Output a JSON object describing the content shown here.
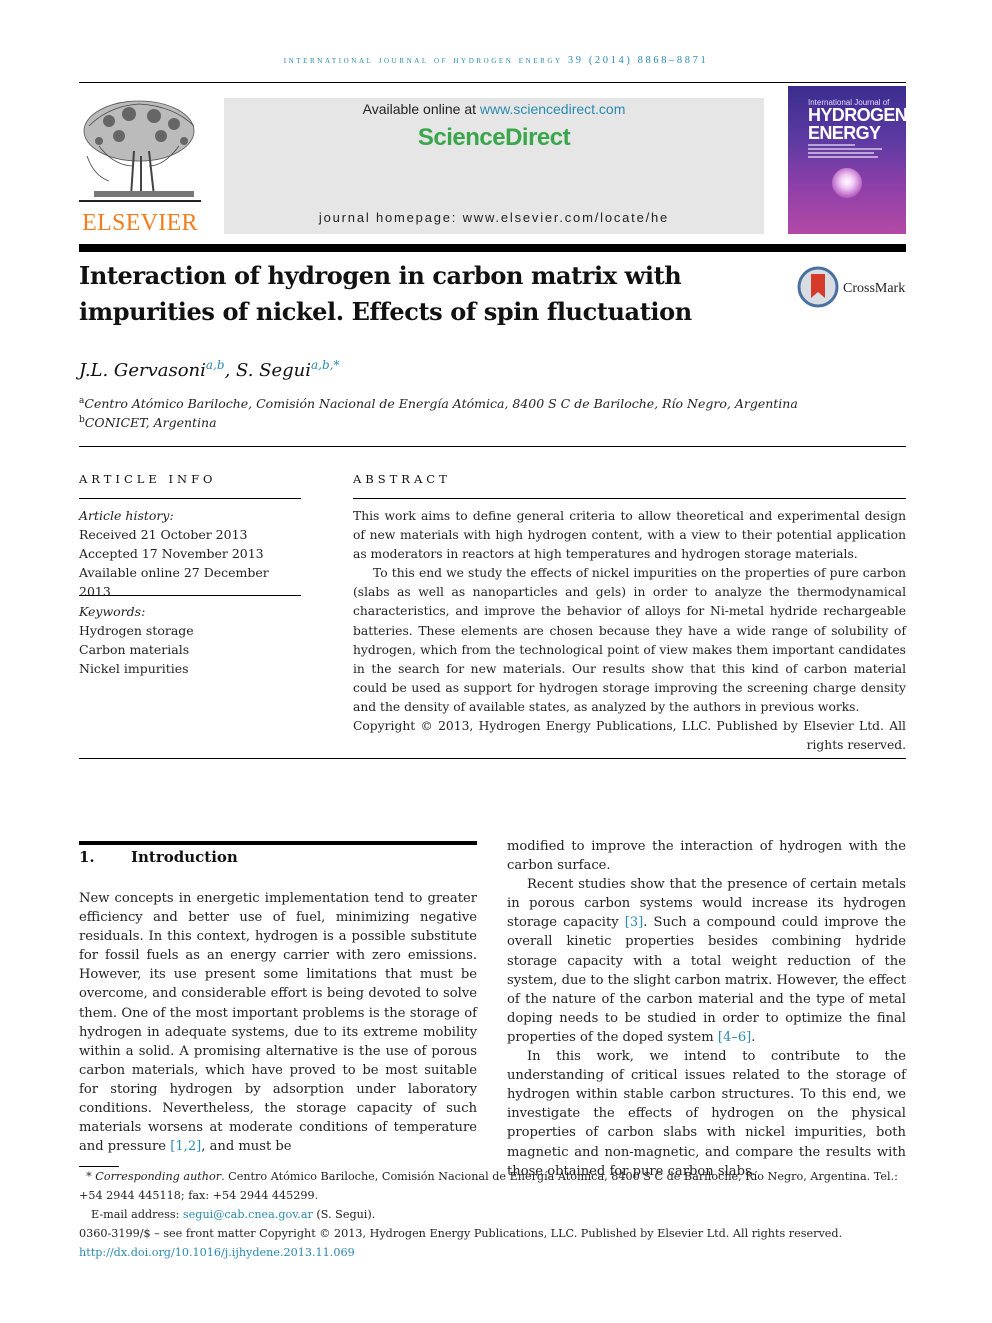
{
  "header": {
    "running_head": "INTERNATIONAL JOURNAL OF HYDROGEN ENERGY 39 (2014) 8868–8871",
    "publisher_logo_text": "ELSEVIER",
    "available_online_prefix": "Available online at ",
    "available_online_link": "www.sciencedirect.com",
    "sciencedirect_brand": "ScienceDirect",
    "journal_homepage": "journal homepage: www.elsevier.com/locate/he",
    "cover": {
      "line1": "International Journal of",
      "line2": "HYDROGEN",
      "line3": "ENERGY"
    },
    "colors": {
      "accent_link": "#2a8ab0",
      "elsevier_orange": "#f07e1e",
      "sciencedirect_green": "#3aa64b"
    }
  },
  "article": {
    "title_line1": "Interaction of hydrogen in carbon matrix with",
    "title_line2": "impurities of nickel. Effects of spin fluctuation",
    "crossmark_label": "CrossMark",
    "authors": [
      {
        "name": "J.L. Gervasoni",
        "affil": "a,b"
      },
      {
        "name": "S. Segui",
        "affil": "a,b,*"
      }
    ],
    "author_separator": ", ",
    "affiliations": [
      {
        "mark": "a",
        "text": "Centro Atómico Bariloche, Comisión Nacional de Energía Atómica, 8400 S C de Bariloche, Río Negro, Argentina"
      },
      {
        "mark": "b",
        "text": "CONICET, Argentina"
      }
    ]
  },
  "article_info": {
    "heading": "ARTICLE INFO",
    "history_label": "Article history:",
    "history": [
      "Received 21 October 2013",
      "Accepted 17 November 2013",
      "Available online 27 December 2013"
    ],
    "keywords_label": "Keywords:",
    "keywords": [
      "Hydrogen storage",
      "Carbon materials",
      "Nickel impurities"
    ]
  },
  "abstract": {
    "heading": "ABSTRACT",
    "paragraph1": "This work aims to define general criteria to allow theoretical and experimental design of new materials with high hydrogen content, with a view to their potential application as moderators in reactors at high temperatures and hydrogen storage materials.",
    "paragraph2": "To this end we study the effects of nickel impurities on the properties of pure carbon (slabs as well as nanoparticles and gels) in order to analyze the thermodynamical characteristics, and improve the behavior of alloys for Ni-metal hydride rechargeable batteries. These elements are chosen because they have a wide range of solubility of hydrogen, which from the technological point of view makes them important candidates in the search for new materials. Our results show that this kind of carbon material could be used as support for hydrogen storage improving the screening charge density and the density of available states, as analyzed by the authors in previous works.",
    "copyright": "Copyright © 2013, Hydrogen Energy Publications, LLC. Published by Elsevier Ltd. All rights reserved."
  },
  "introduction": {
    "number": "1.",
    "heading": "Introduction",
    "left_p1_before_ref": "New concepts in energetic implementation tend to greater efficiency and better use of fuel, minimizing negative residuals. In this context, hydrogen is a possible substitute for fossil fuels as an energy carrier with zero emissions. However, its use present some limitations that must be overcome, and considerable effort is being devoted to solve them. One of the most important problems is the storage of hydrogen in adequate systems, due to its extreme mobility within a solid. A promising alternative is the use of porous carbon materials, which have proved to be most suitable for storing hydrogen by adsorption under laboratory conditions. Nevertheless, the storage capacity of such materials worsens at moderate conditions of temperature and pressure ",
    "left_p1_ref": "[1,2]",
    "left_p1_after_ref": ", and must be",
    "right_p1": "modified to improve the interaction of hydrogen with the carbon surface.",
    "right_p2_before_ref": "Recent studies show that the presence of certain metals in porous carbon systems would increase its hydrogen storage capacity ",
    "right_p2_ref": "[3]",
    "right_p2_middle": ". Such a compound could improve the overall kinetic properties besides combining hydride storage capacity with a total weight reduction of the system, due to the slight carbon matrix. However, the effect of the nature of the carbon material and the type of metal doping needs to be studied in order to optimize the final properties of the doped system ",
    "right_p2_ref2": "[4–6]",
    "right_p2_end": ".",
    "right_p3": "In this work, we intend to contribute to the understanding of critical issues related to the storage of hydrogen within stable carbon structures. To this end, we investigate the effects of hydrogen on the physical properties of carbon slabs with nickel impurities, both magnetic and non-magnetic, and compare the results with those obtained for pure carbon slabs."
  },
  "footnotes": {
    "corresponding_mark": "*",
    "corresponding_label": "Corresponding author",
    "corresponding_text": ". Centro Atómico Bariloche, Comisión Nacional de Energía Atómica, 8400 S C de Bariloche, Río Negro, Argentina. Tel.: +54 2944 445118; fax: +54 2944 445299.",
    "email_label": "E-mail address: ",
    "email": "segui@cab.cnea.gov.ar",
    "email_suffix": " (S. Segui).",
    "issn_line": "0360-3199/$ – see front matter Copyright © 2013, Hydrogen Energy Publications, LLC. Published by Elsevier Ltd. All rights reserved.",
    "doi": "http://dx.doi.org/10.1016/j.ijhydene.2013.11.069"
  }
}
